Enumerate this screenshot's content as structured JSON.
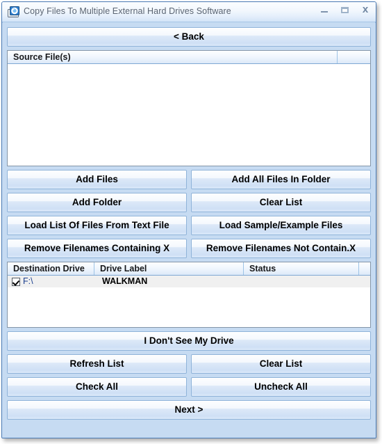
{
  "window": {
    "title": "Copy Files To Multiple External Hard Drives Software",
    "icon": "copy-drives-icon",
    "controls": {
      "minimize": "minimize-icon",
      "maximize": "maximize-icon",
      "close": "close-icon"
    }
  },
  "nav": {
    "back_label": "< Back",
    "next_label": "Next >"
  },
  "source_list": {
    "columns": [
      "Source File(s)",
      ""
    ],
    "rows": []
  },
  "source_buttons": {
    "add_files": "Add Files",
    "add_all_files_in_folder": "Add All Files In Folder",
    "add_folder": "Add Folder",
    "clear_list": "Clear List",
    "load_list_from_text_file": "Load List Of Files From Text File",
    "load_sample_files": "Load Sample/Example Files",
    "remove_containing_x": "Remove Filenames Containing X",
    "remove_not_containing_x": "Remove Filenames Not Contain.X"
  },
  "destination_list": {
    "columns": [
      "Destination Drive",
      "Drive Label",
      "Status",
      ""
    ],
    "rows": [
      {
        "checked": true,
        "drive": "F:\\",
        "label": "WALKMAN",
        "status": ""
      }
    ]
  },
  "destination_buttons": {
    "dont_see_drive": "I Don't See My Drive",
    "refresh_list": "Refresh List",
    "clear_list": "Clear List",
    "check_all": "Check All",
    "uncheck_all": "Uncheck All"
  },
  "colors": {
    "window_background": "#c6dbf2",
    "window_border": "#4a7ab5",
    "title_text": "#5a6472",
    "button_border": "#8fb3d9",
    "row_highlight": "#f0f0f0",
    "drive_text": "#1b3f8f"
  }
}
